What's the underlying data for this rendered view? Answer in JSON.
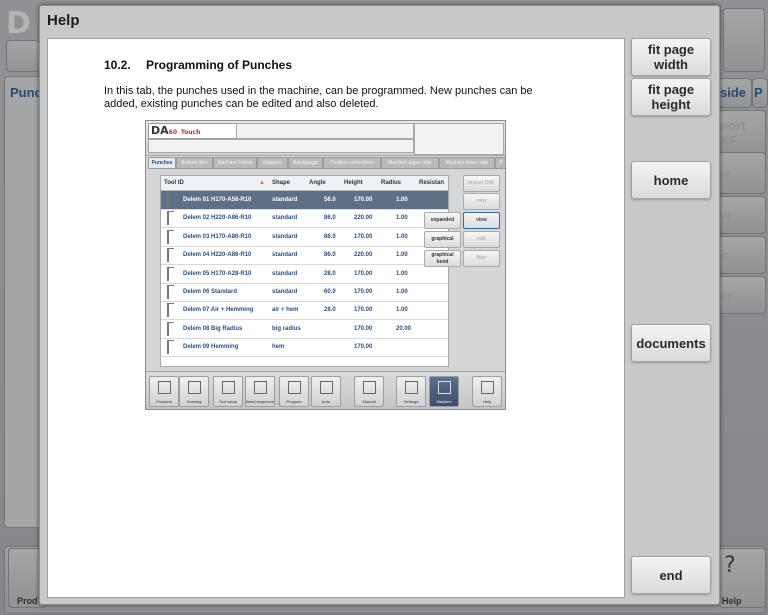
{
  "background_app": {
    "tab_partial": "Punc",
    "side_partials": [
      "side",
      "P",
      "port",
      "XF",
      "w",
      "w",
      "it",
      "er"
    ],
    "bottom_left_label": "Prod",
    "bottom_right_label": "Help",
    "help_icon": "question-icon"
  },
  "dialog": {
    "title": "Help",
    "buttons": {
      "fit_width": "fit page width",
      "fit_height": "fit page height",
      "home": "home",
      "documents": "documents",
      "end": "end"
    }
  },
  "document": {
    "section_number": "10.2.",
    "section_title": "Programming of Punches",
    "body": "In this tab, the punches used in the machine, can be programmed. New punches can be added, existing punches can be edited and also deleted."
  },
  "screenshot": {
    "logo": "DA",
    "logo_model": "60",
    "logo_sub": "Touch",
    "tabs": [
      "Punches",
      "Bottom dies",
      "Machine Frame",
      "Adapters",
      "Backgauge",
      "Position corrections",
      "Machine upper side",
      "Machine lower side",
      "P"
    ],
    "columns": [
      "Tool ID",
      "Shape",
      "Angle",
      "Height",
      "Radius",
      "Resistan"
    ],
    "rows": [
      {
        "id": "Delem 01 H170-A56-R10",
        "shape": "standard",
        "angle": "56.0",
        "height": "170.00",
        "radius": "1.00"
      },
      {
        "id": "Delem 02 H220-A86-R10",
        "shape": "standard",
        "angle": "86.0",
        "height": "220.00",
        "radius": "1.00"
      },
      {
        "id": "Delem 03 H170-A86-R10",
        "shape": "standard",
        "angle": "86.0",
        "height": "170.00",
        "radius": "1.00"
      },
      {
        "id": "Delem 04 H220-A86-R10",
        "shape": "standard",
        "angle": "86.0",
        "height": "220.00",
        "radius": "1.00"
      },
      {
        "id": "Delem 05 H170-A28-R10",
        "shape": "standard",
        "angle": "28.0",
        "height": "170.00",
        "radius": "1.00"
      },
      {
        "id": "Delem 06 Standard",
        "shape": "standard",
        "angle": "60.0",
        "height": "170.00",
        "radius": "1.00"
      },
      {
        "id": "Delem 07 Air + Hemming",
        "shape": "air + hem",
        "angle": "28.0",
        "height": "170.00",
        "radius": "1.00"
      },
      {
        "id": "Delem 08 Big Radius",
        "shape": "big radius",
        "angle": "",
        "height": "170.00",
        "radius": "20.00"
      },
      {
        "id": "Delem 09 Hemming",
        "shape": "hem",
        "angle": "",
        "height": "170.00",
        "radius": ""
      }
    ],
    "side_buttons": [
      "import DXF",
      "new",
      "expanded",
      "view",
      "graphical",
      "edit",
      "graphical bend",
      "filter"
    ],
    "bottom_buttons": [
      "Products",
      "Drawing",
      "Tool setup",
      "Bend sequence",
      "Program",
      "Auto",
      "Manual",
      "Settings",
      "Machine",
      "Help"
    ],
    "active_bottom": "Machine"
  }
}
